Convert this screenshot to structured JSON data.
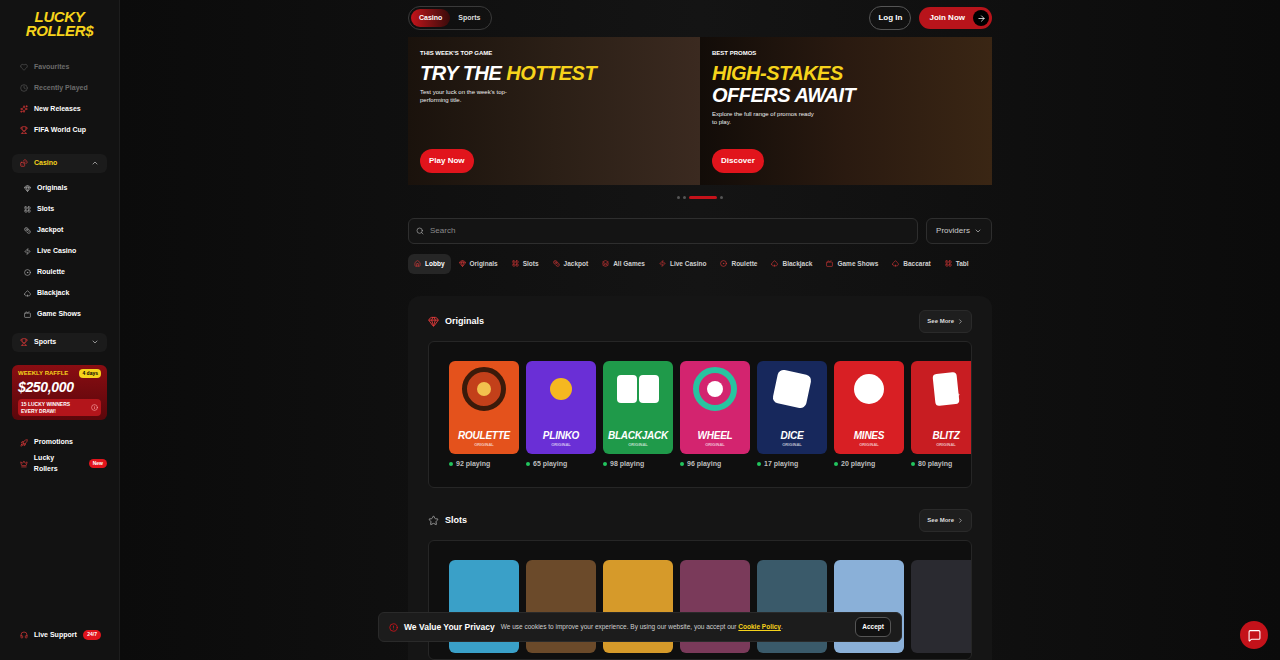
{
  "sidebar": {
    "logo": [
      "LUCKY",
      "ROLLER$"
    ],
    "top_items": [
      {
        "label": "Favourites",
        "disabled": true
      },
      {
        "label": "Recently Played",
        "disabled": true
      },
      {
        "label": "New Releases",
        "disabled": false
      },
      {
        "label": "FIFA World Cup",
        "disabled": false
      }
    ],
    "groups": [
      {
        "label": "Casino",
        "expanded": true,
        "items": [
          "Originals",
          "Slots",
          "Jackpot",
          "Live Casino",
          "Roulette",
          "Blackjack",
          "Game Shows"
        ]
      },
      {
        "label": "Sports",
        "expanded": false,
        "items": []
      }
    ],
    "raffle": {
      "title": "WEEKLY RAFFLE",
      "badge": "4 days",
      "amount": "$250,000",
      "subtitle": "15 LUCKY WINNERS EVERY DRAW!"
    },
    "bottom_items": [
      {
        "label": "Promotions",
        "badge": ""
      },
      {
        "label": "Lucky Rollers",
        "badge": "New"
      }
    ],
    "support": {
      "label": "Live Support",
      "badge": "24/7"
    }
  },
  "header": {
    "toggle": [
      {
        "label": "Casino",
        "selected": true
      },
      {
        "label": "Sports",
        "selected": false
      }
    ],
    "login": "Log In",
    "join": "Join Now"
  },
  "banners": [
    {
      "eyebrow": "THIS WEEK'S TOP GAME",
      "title": [
        [
          {
            "text": "TRY THE",
            "highlight": false
          },
          {
            "text": "HOTTEST",
            "highlight": true
          }
        ]
      ],
      "subtitle": "Test your luck on the week's top-performing title.",
      "button": "Play Now"
    },
    {
      "eyebrow": "BEST PROMOS",
      "title": [
        [
          {
            "text": "HIGH-STAKES",
            "highlight": true
          }
        ],
        [
          {
            "text": "OFFERS AWAIT",
            "highlight": false
          }
        ]
      ],
      "subtitle": "Explore the full range of promos ready to play.",
      "button": "Discover"
    }
  ],
  "carousel": {
    "dots": [
      {
        "selected": false
      },
      {
        "selected": false
      },
      {
        "selected": true
      },
      {
        "selected": false
      }
    ]
  },
  "search": {
    "placeholder": "Search",
    "providers": "Providers"
  },
  "tabs": [
    {
      "label": "Lobby",
      "selected": true
    },
    {
      "label": "Originals",
      "selected": false
    },
    {
      "label": "Slots",
      "selected": false
    },
    {
      "label": "Jackpot",
      "selected": false
    },
    {
      "label": "All Games",
      "selected": false
    },
    {
      "label": "Live Casino",
      "selected": false
    },
    {
      "label": "Roulette",
      "selected": false
    },
    {
      "label": "Blackjack",
      "selected": false
    },
    {
      "label": "Game Shows",
      "selected": false
    },
    {
      "label": "Baccarat",
      "selected": false
    },
    {
      "label": "Tabl",
      "selected": false
    }
  ],
  "sections": [
    {
      "title": "Originals",
      "see_more": "See More",
      "games": [
        {
          "name": "ROULETTE",
          "tag": "ORIGINAL",
          "playing": "92 playing",
          "color": "#e4521c"
        },
        {
          "name": "PLINKO",
          "tag": "ORIGINAL",
          "playing": "65 playing",
          "color": "#6a2fd6"
        },
        {
          "name": "BLACKJACK",
          "tag": "ORIGINAL",
          "playing": "98 playing",
          "color": "#1f9a4a"
        },
        {
          "name": "WHEEL",
          "tag": "ORIGINAL",
          "playing": "96 playing",
          "color": "#d3246f"
        },
        {
          "name": "DICE",
          "tag": "ORIGINAL",
          "playing": "17 playing",
          "color": "#17285c"
        },
        {
          "name": "MINES",
          "tag": "ORIGINAL",
          "playing": "20 playing",
          "color": "#d81f24"
        },
        {
          "name": "BLITZ",
          "tag": "ORIGINAL",
          "playing": "80 playing",
          "color": "#c81d22"
        }
      ]
    },
    {
      "title": "Slots",
      "see_more": "See More",
      "games": []
    }
  ],
  "cookie": {
    "title": "We Value Your Privacy",
    "text": "We use cookies to improve your experience. By using our website, you accept our",
    "link": "Cookie Policy",
    "end": ".",
    "button": "Accept"
  }
}
